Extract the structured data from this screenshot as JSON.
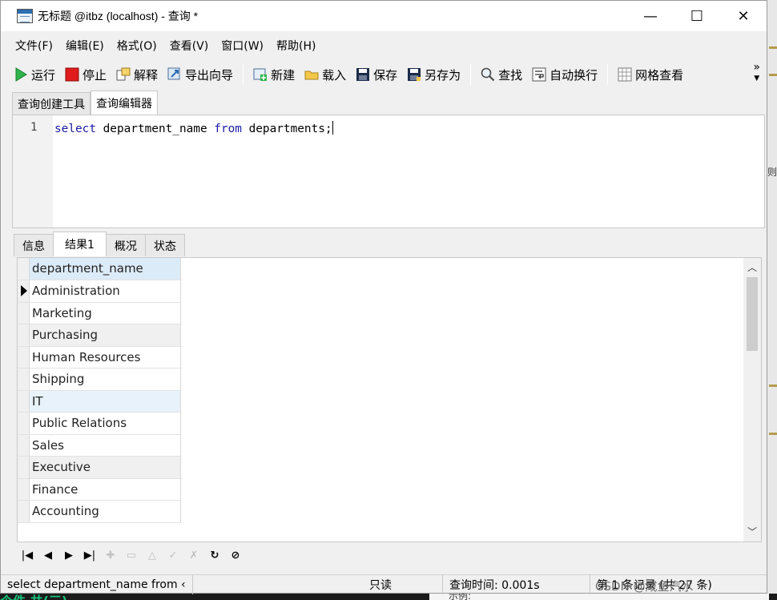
{
  "window": {
    "title": "无标题 @itbz (localhost) - 查询 *",
    "controls": {
      "minimize": "—",
      "maximize": "☐",
      "close": "✕"
    }
  },
  "menu": [
    "文件(F)",
    "编辑(E)",
    "格式(O)",
    "查看(V)",
    "窗口(W)",
    "帮助(H)"
  ],
  "toolbar": {
    "run": "运行",
    "stop": "停止",
    "explain": "解释",
    "export_wizard": "导出向导",
    "new": "新建",
    "load": "载入",
    "save": "保存",
    "save_as": "另存为",
    "find": "查找",
    "word_wrap": "自动换行",
    "grid_view": "网格查看",
    "more": "»"
  },
  "editor_tabs": [
    "查询创建工具",
    "查询编辑器"
  ],
  "editor": {
    "line_number": "1",
    "code": {
      "kw1": "select",
      "t1": " department_name ",
      "kw2": "from",
      "t2": " departments;"
    }
  },
  "result_tabs": [
    "信息",
    "结果1",
    "概况",
    "状态"
  ],
  "grid": {
    "column": "department_name",
    "rows": [
      "Administration",
      "Marketing",
      "Purchasing",
      "Human Resources",
      "Shipping",
      "IT",
      "Public Relations",
      "Sales",
      "Executive",
      "Finance",
      "Accounting"
    ]
  },
  "status": {
    "query_preview": "select department_name from ‹",
    "readonly": "只读",
    "query_time": "查询时间: 0.001s",
    "record_info": "第 1 条记录 (共 27 条)"
  },
  "watermark": "CSDN @咸鱼汽水",
  "background": {
    "right_char": "则。",
    "bottom_left": "个件 井(三)",
    "bottom_right": "示例:"
  }
}
